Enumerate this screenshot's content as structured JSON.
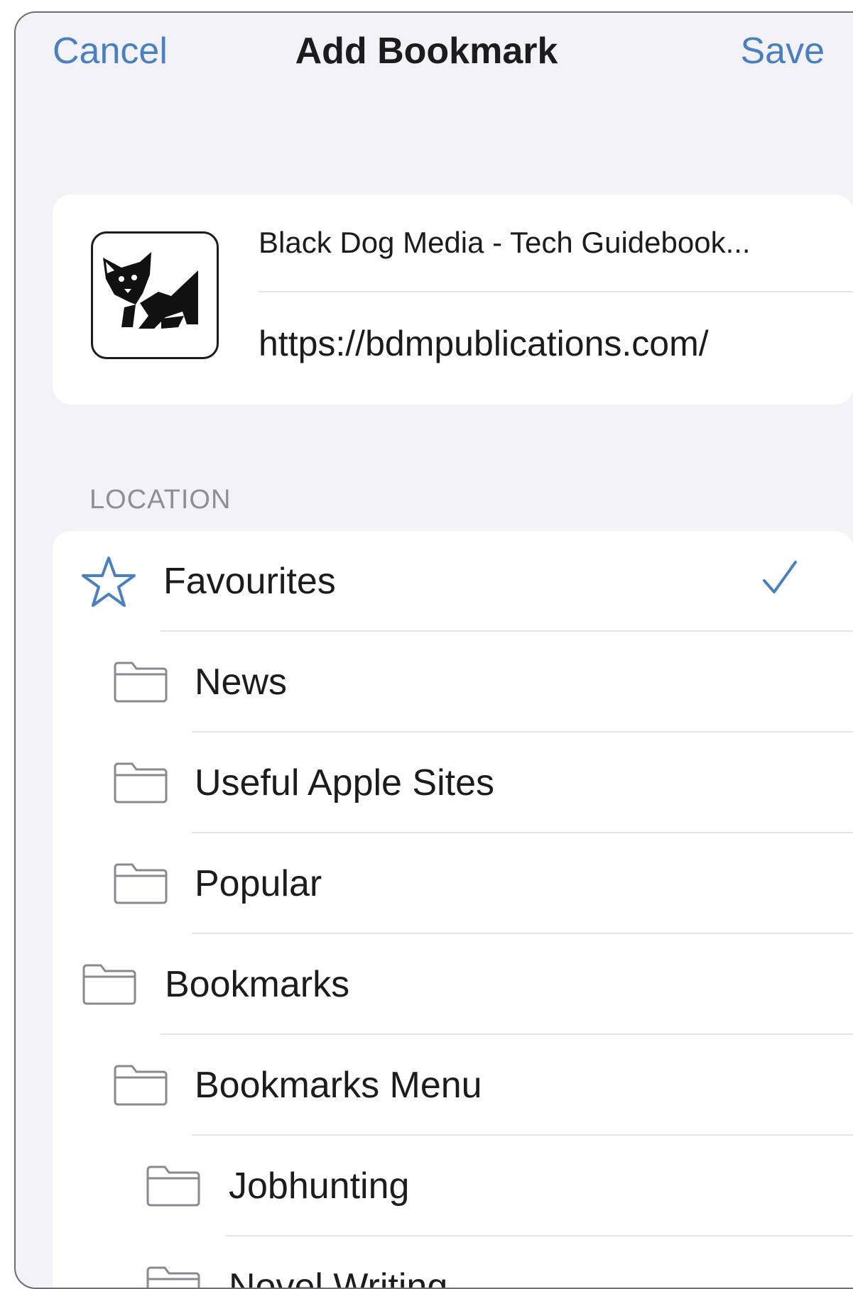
{
  "nav": {
    "cancel_label": "Cancel",
    "title": "Add Bookmark",
    "save_label": "Save"
  },
  "bookmark": {
    "title": "Black Dog Media - Tech Guidebook...",
    "url": "https://bdmpublications.com/",
    "thumbnail_icon": "black-dog-logo-icon"
  },
  "location": {
    "section_label": "LOCATION",
    "selected": "Favourites",
    "items": [
      {
        "label": "Favourites",
        "icon": "star-icon",
        "level": 0,
        "checked": true
      },
      {
        "label": "News",
        "icon": "folder-icon",
        "level": 1
      },
      {
        "label": "Useful Apple Sites",
        "icon": "folder-icon",
        "level": 1
      },
      {
        "label": "Popular",
        "icon": "folder-icon",
        "level": 1
      },
      {
        "label": "Bookmarks",
        "icon": "folder-icon",
        "level": 0
      },
      {
        "label": "Bookmarks Menu",
        "icon": "folder-icon",
        "level": 1
      },
      {
        "label": "Jobhunting",
        "icon": "folder-icon",
        "level": 2
      },
      {
        "label": "Novel Writing",
        "icon": "folder-icon",
        "level": 2
      }
    ]
  },
  "colors": {
    "accent": "#4a7fc2",
    "background": "#f2f2f7",
    "card": "#ffffff",
    "separator": "#e3e3e8",
    "secondary_text": "#8e8e93"
  }
}
